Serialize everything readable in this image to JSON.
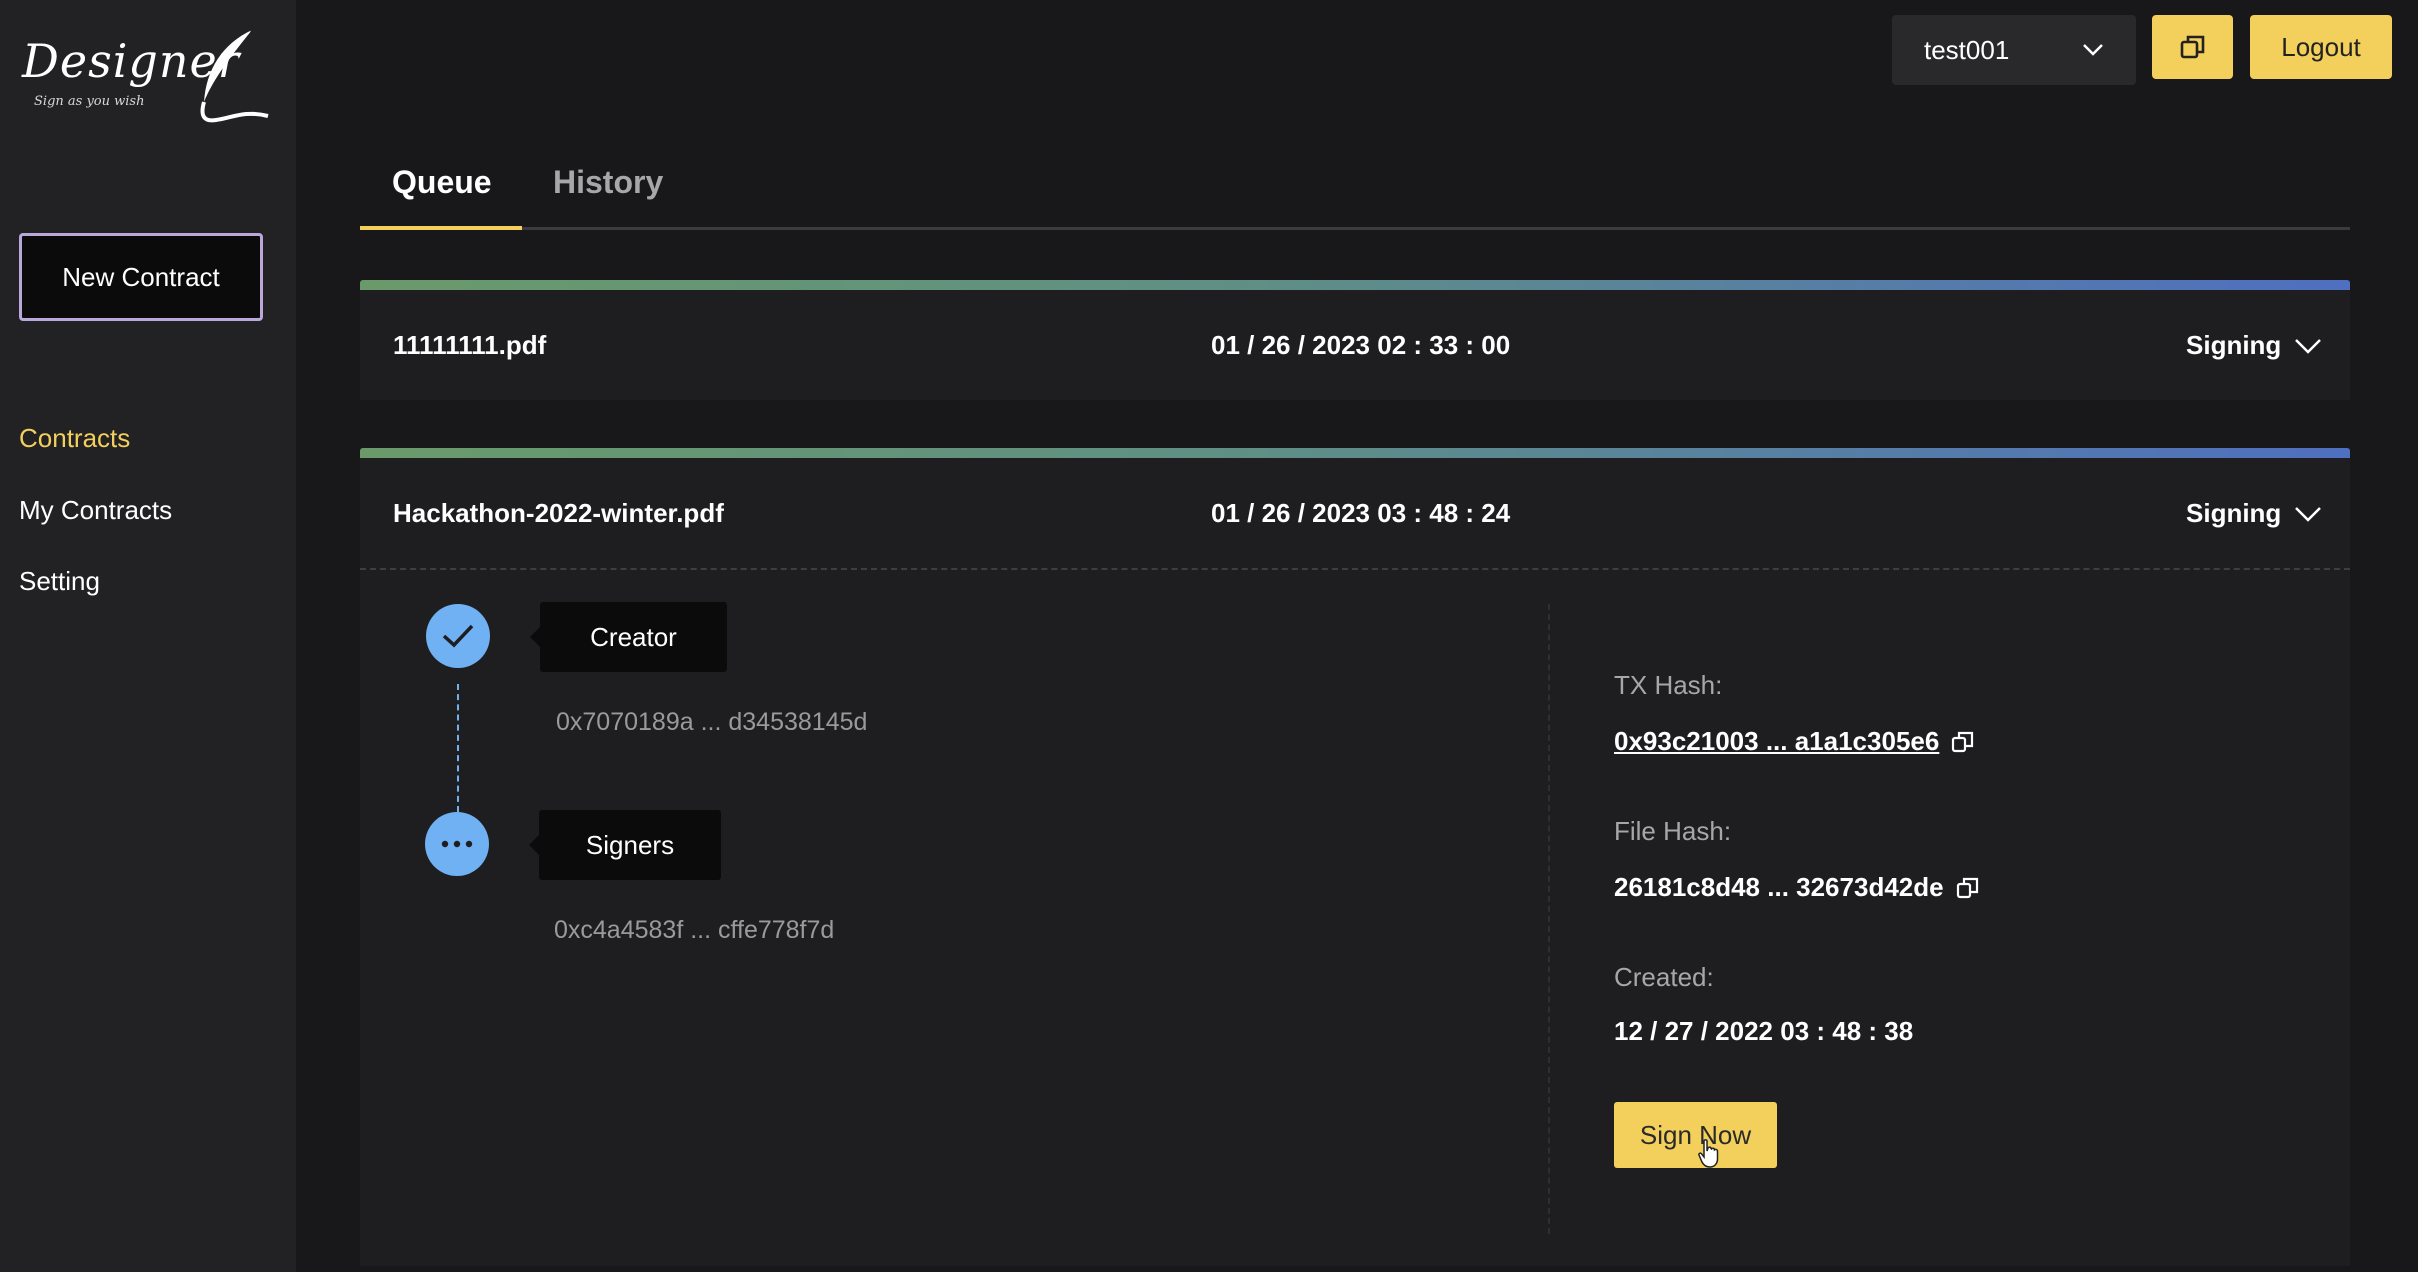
{
  "brand": {
    "name": "Designer",
    "tagline": "Sign as you wish"
  },
  "sidebar": {
    "new_contract_label": "New Contract",
    "items": [
      {
        "label": "Contracts",
        "active": true
      },
      {
        "label": "My Contracts",
        "active": false
      },
      {
        "label": "Setting",
        "active": false
      }
    ]
  },
  "header": {
    "account": "test001",
    "logout_label": "Logout"
  },
  "tabs": [
    {
      "label": "Queue",
      "active": true
    },
    {
      "label": "History",
      "active": false
    }
  ],
  "contracts": [
    {
      "file": "11111111.pdf",
      "date": "01 / 26 / 2023 02 : 33 : 00",
      "status": "Signing",
      "expanded": false
    },
    {
      "file": "Hackathon-2022-winter.pdf",
      "date": "01 / 26 / 2023 03 : 48 : 24",
      "status": "Signing",
      "expanded": true,
      "timeline": [
        {
          "label": "Creator",
          "address": "0x7070189a ... d34538145d",
          "state": "done"
        },
        {
          "label": "Signers",
          "address": "0xc4a4583f ... cffe778f7d",
          "state": "pending"
        }
      ],
      "details": {
        "tx_hash_label": "TX Hash:",
        "tx_hash": "0x93c21003 ... a1a1c305e6",
        "file_hash_label": "File Hash:",
        "file_hash": "26181c8d48 ... 32673d42de",
        "created_label": "Created:",
        "created": "12 / 27 / 2022 03 : 48 : 38"
      },
      "sign_label": "Sign Now"
    }
  ],
  "colors": {
    "accent": "#f3cf5b",
    "timeline": "#6fb1f2",
    "background": "#18181a",
    "sidebar": "#222225"
  }
}
